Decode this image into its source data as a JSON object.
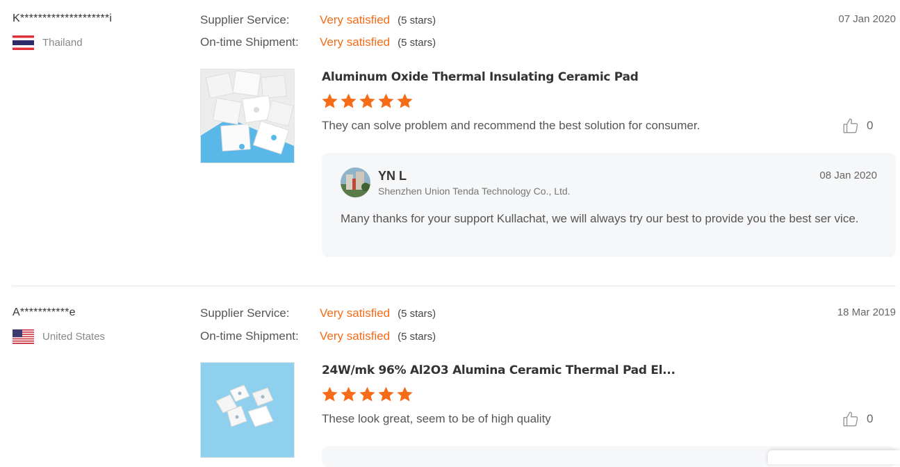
{
  "reviews": [
    {
      "buyer": "K********************i",
      "country": "Thailand",
      "flag_icon": "thailand-flag-icon",
      "supplier_service_label": "Supplier Service:",
      "supplier_service_value": "Very satisfied",
      "supplier_service_stars": "(5 stars)",
      "shipment_label": "On-time Shipment:",
      "shipment_value": "Very satisfied",
      "shipment_stars": "(5 stars)",
      "date": "07 Jan 2020",
      "product_title": "Aluminum Oxide Thermal Insulating Ceramic Pad",
      "rating": 5,
      "comment": "They can solve problem and recommend the best solution for consumer.",
      "likes": "0",
      "reply": {
        "name": "YN L",
        "company": "Shenzhen Union Tenda Technology Co., Ltd.",
        "date": "08 Jan 2020",
        "text": "Many thanks for your support Kullachat, we will always try our best to provide you the best ser vice."
      }
    },
    {
      "buyer": "A***********e",
      "country": "United States",
      "flag_icon": "usa-flag-icon",
      "supplier_service_label": "Supplier Service:",
      "supplier_service_value": "Very satisfied",
      "supplier_service_stars": "(5 stars)",
      "shipment_label": "On-time Shipment:",
      "shipment_value": "Very satisfied",
      "shipment_stars": "(5 stars)",
      "date": "18 Mar 2019",
      "product_title": "24W/mk 96% Al2O3 Alumina Ceramic Thermal Pad El...",
      "rating": 5,
      "comment": "These look great, seem to be of high quality",
      "likes": "0"
    }
  ],
  "colors": {
    "accent": "#f56b17",
    "star": "#f56b17",
    "reply_bg": "#f6f7f9"
  }
}
